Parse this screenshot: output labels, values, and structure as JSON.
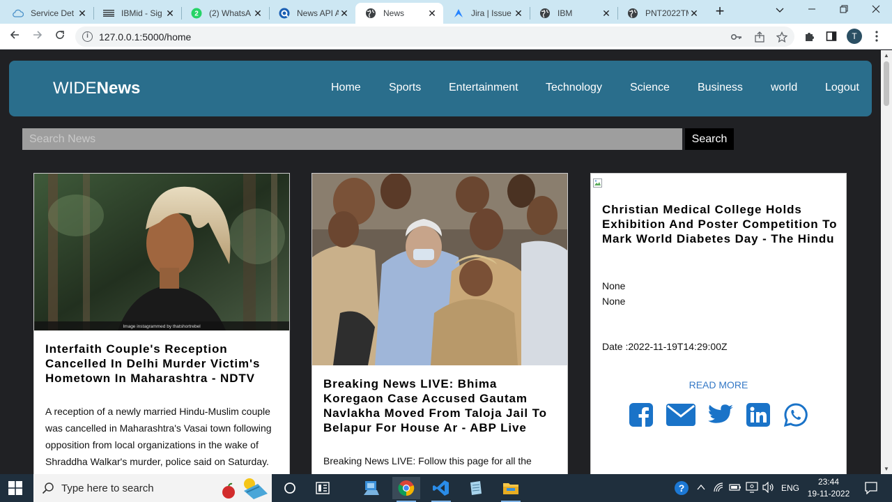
{
  "browser": {
    "tabs": [
      {
        "label": "Service Det",
        "icon": "cloud-icon"
      },
      {
        "label": "IBMid - Sig",
        "icon": "ibm-icon"
      },
      {
        "label": "(2) WhatsA",
        "icon": "whatsapp-icon"
      },
      {
        "label": "News API A",
        "icon": "newsapi-icon"
      },
      {
        "label": "News",
        "icon": "globe-icon"
      },
      {
        "label": "Jira | Issue",
        "icon": "jira-icon"
      },
      {
        "label": "IBM",
        "icon": "globe-icon"
      },
      {
        "label": "PNT2022TM",
        "icon": "globe-icon"
      }
    ],
    "active_tab": 4,
    "url": "127.0.0.1:5000/home",
    "profile_initial": "T"
  },
  "site": {
    "logo_light": "WIDE",
    "logo_bold": "News",
    "nav": [
      "Home",
      "Sports",
      "Entertainment",
      "Technology",
      "Science",
      "Business",
      "world",
      "Logout"
    ],
    "search_placeholder": "Search News",
    "search_button": "Search"
  },
  "articles": [
    {
      "title": "Interfaith Couple's Reception Cancelled In Delhi Murder Victim's Hometown In Maharashtra - NDTV",
      "description": "A reception of a newly married Hindu-Muslim couple was cancelled in Maharashtra's Vasai town following opposition from local organizations in the wake of Shraddha Walkar's murder, police said on Saturday.",
      "image_caption": "Image instagrammed by thatshortrebel"
    },
    {
      "title": "Breaking News LIVE: Bhima Koregaon Case Accused Gautam Navlakha Moved From Taloja Jail To Belapur For House Ar - ABP Live",
      "description": "Breaking News LIVE: Follow this page for all the"
    },
    {
      "title": "Christian Medical College Holds Exhibition And Poster Competition To Mark World Diabetes Day - The Hindu",
      "author": "None",
      "description": "None",
      "date": "Date :2022-11-19T14:29:00Z",
      "read_more": "READ MORE"
    }
  ],
  "taskbar": {
    "search_placeholder": "Type here to search",
    "language": "ENG",
    "time": "23:44",
    "date": "19-11-2022"
  },
  "colors": {
    "header_bg": "#2a6e8c",
    "page_bg": "#202124",
    "tabbar_bg": "#cde7f3",
    "link": "#3478c6",
    "share_icon": "#1a73c8"
  }
}
